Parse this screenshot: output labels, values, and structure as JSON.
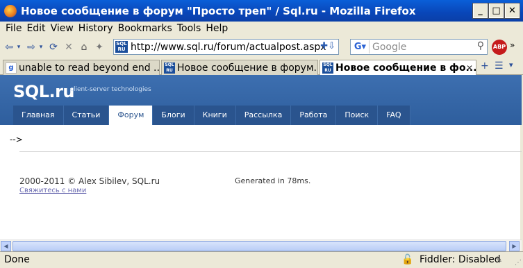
{
  "window": {
    "title": "Новое сообщение в форум \"Просто треп\" / Sql.ru - Mozilla Firefox",
    "minimize": "_",
    "maximize": "□",
    "close": "✕"
  },
  "menu": [
    "File",
    "Edit",
    "View",
    "History",
    "Bookmarks",
    "Tools",
    "Help"
  ],
  "toolbar": {
    "url": "http://www.sql.ru/forum/actualpost.aspx",
    "search_placeholder": "Google",
    "adblock_label": "ABP"
  },
  "tabs": [
    {
      "label": "unable to read beyond end ...",
      "icon": "google-favicon"
    },
    {
      "label": "Новое сообщение в форум...",
      "icon": "sqlru-favicon"
    },
    {
      "label": "Новое сообщение в фо...",
      "icon": "sqlru-favicon",
      "active": true
    }
  ],
  "site": {
    "logo": "SQL.ru",
    "tagline": "client-server technologies",
    "nav": [
      "Главная",
      "Статьи",
      "Форум",
      "Блоги",
      "Книги",
      "Рассылка",
      "Работа",
      "Поиск",
      "FAQ"
    ],
    "active_nav": "Форум",
    "artifact_text": "-->",
    "copyright": "2000-2011 © Alex Sibilev, SQL.ru",
    "contact_link": "Свяжитесь с нами",
    "generated": "Generated in 78ms."
  },
  "status": {
    "text": "Done",
    "fiddler": "Fiddler: Disabled"
  },
  "colors": {
    "titlebar": "#0a4fc8",
    "site_header": "#3d6fb0",
    "site_nav": "#2a548e"
  }
}
